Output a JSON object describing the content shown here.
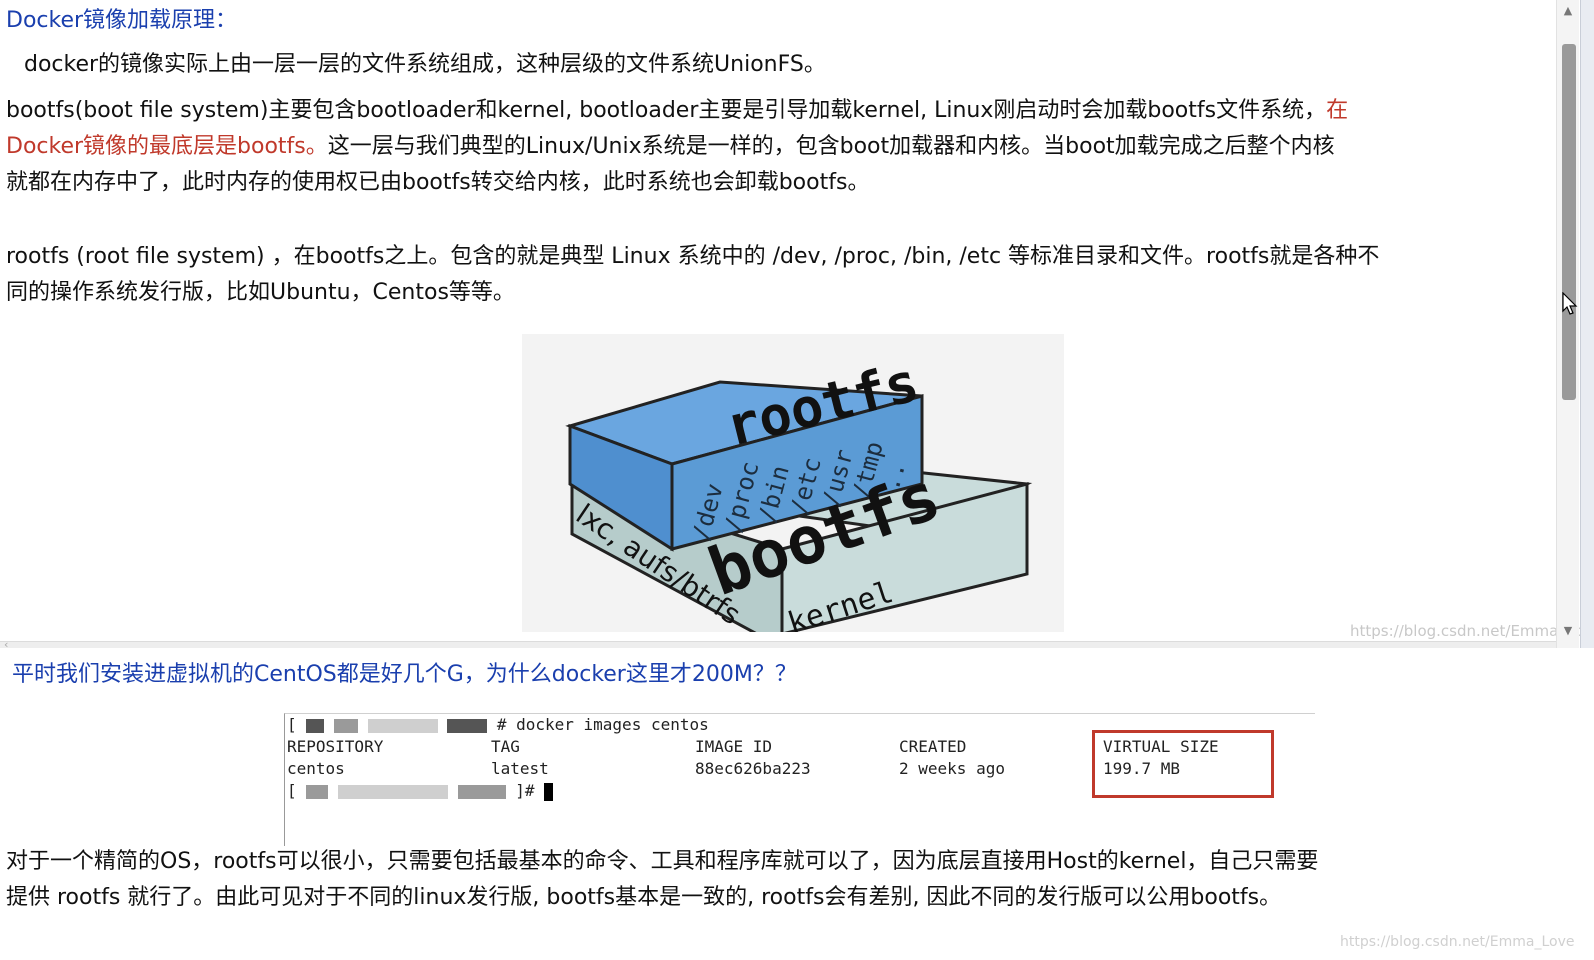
{
  "section1": {
    "heading": "Docker镜像加载原理：",
    "para1": "docker的镜像实际上由一层一层的文件系统组成，这种层级的文件系统UnionFS。",
    "para2_line1_a": "bootfs(boot file system)主要包含bootloader和kernel, bootloader主要是引导加载kernel, Linux刚启动时会加载bootfs文件系统，",
    "para2_line1_red": "在",
    "para2_line2_red": "Docker镜像的最底层是bootfs。",
    "para2_line2_b": "这一层与我们典型的Linux/Unix系统是一样的，包含boot加载器和内核。当boot加载完成之后整个内核",
    "para2_line3": "就都在内存中了，此时内存的使用权已由bootfs转交给内核，此时系统也会卸载bootfs。",
    "para3_line1": "rootfs (root file system) ，在bootfs之上。包含的就是典型 Linux 系统中的 /dev, /proc, /bin, /etc 等标准目录和文件。rootfs就是各种不",
    "para3_line2": "同的操作系统发行版，比如Ubuntu，Centos等等。"
  },
  "figure": {
    "top_label": "rootfs",
    "dirs": [
      "/dev",
      "/proc",
      "/bin",
      "/etc",
      "/usr",
      "/tmp",
      ".."
    ],
    "bottom_label": "bootfs",
    "side_label": "lxc, aufs/btrfs",
    "front_label": "kernel",
    "colors": {
      "top": "#5b9bd5",
      "bottom": "#c9dcdb"
    }
  },
  "watermark": "https://blog.csdn.net/Emma_Lov",
  "section2": {
    "question": "平时我们安装进虚拟机的CentOS都是好几个G，为什么docker这里才200M？？",
    "terminal": {
      "command": "# docker images centos",
      "headers": [
        "REPOSITORY",
        "TAG",
        "IMAGE ID",
        "CREATED",
        "VIRTUAL SIZE"
      ],
      "row": [
        "centos",
        "latest",
        "88ec626ba223",
        "2 weeks ago",
        "199.7 MB"
      ],
      "prompt_end": "]#"
    },
    "para_line1": "对于一个精简的OS，rootfs可以很小，只需要包括最基本的命令、工具和程序库就可以了，因为底层直接用Host的kernel，自己只需要",
    "para_line2": "提供 rootfs 就行了。由此可见对于不同的linux发行版, bootfs基本是一致的, rootfs会有差别, 因此不同的发行版可以公用bootfs。",
    "watermark": "https://blog.csdn.net/Emma_Love"
  }
}
